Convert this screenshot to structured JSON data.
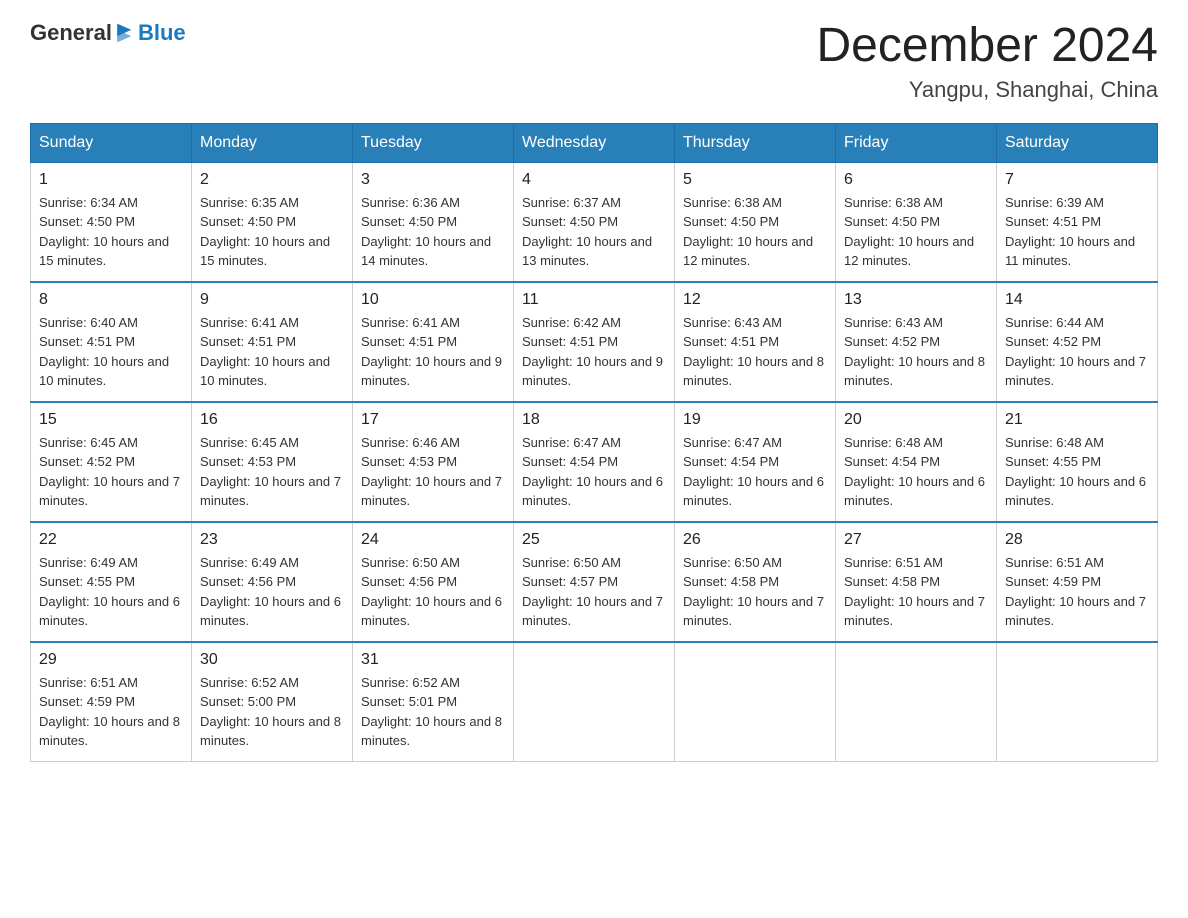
{
  "header": {
    "logo_general": "General",
    "logo_blue": "Blue",
    "month": "December 2024",
    "location": "Yangpu, Shanghai, China"
  },
  "days_of_week": [
    "Sunday",
    "Monday",
    "Tuesday",
    "Wednesday",
    "Thursday",
    "Friday",
    "Saturday"
  ],
  "weeks": [
    [
      {
        "day": "1",
        "sunrise": "6:34 AM",
        "sunset": "4:50 PM",
        "daylight": "10 hours and 15 minutes."
      },
      {
        "day": "2",
        "sunrise": "6:35 AM",
        "sunset": "4:50 PM",
        "daylight": "10 hours and 15 minutes."
      },
      {
        "day": "3",
        "sunrise": "6:36 AM",
        "sunset": "4:50 PM",
        "daylight": "10 hours and 14 minutes."
      },
      {
        "day": "4",
        "sunrise": "6:37 AM",
        "sunset": "4:50 PM",
        "daylight": "10 hours and 13 minutes."
      },
      {
        "day": "5",
        "sunrise": "6:38 AM",
        "sunset": "4:50 PM",
        "daylight": "10 hours and 12 minutes."
      },
      {
        "day": "6",
        "sunrise": "6:38 AM",
        "sunset": "4:50 PM",
        "daylight": "10 hours and 12 minutes."
      },
      {
        "day": "7",
        "sunrise": "6:39 AM",
        "sunset": "4:51 PM",
        "daylight": "10 hours and 11 minutes."
      }
    ],
    [
      {
        "day": "8",
        "sunrise": "6:40 AM",
        "sunset": "4:51 PM",
        "daylight": "10 hours and 10 minutes."
      },
      {
        "day": "9",
        "sunrise": "6:41 AM",
        "sunset": "4:51 PM",
        "daylight": "10 hours and 10 minutes."
      },
      {
        "day": "10",
        "sunrise": "6:41 AM",
        "sunset": "4:51 PM",
        "daylight": "10 hours and 9 minutes."
      },
      {
        "day": "11",
        "sunrise": "6:42 AM",
        "sunset": "4:51 PM",
        "daylight": "10 hours and 9 minutes."
      },
      {
        "day": "12",
        "sunrise": "6:43 AM",
        "sunset": "4:51 PM",
        "daylight": "10 hours and 8 minutes."
      },
      {
        "day": "13",
        "sunrise": "6:43 AM",
        "sunset": "4:52 PM",
        "daylight": "10 hours and 8 minutes."
      },
      {
        "day": "14",
        "sunrise": "6:44 AM",
        "sunset": "4:52 PM",
        "daylight": "10 hours and 7 minutes."
      }
    ],
    [
      {
        "day": "15",
        "sunrise": "6:45 AM",
        "sunset": "4:52 PM",
        "daylight": "10 hours and 7 minutes."
      },
      {
        "day": "16",
        "sunrise": "6:45 AM",
        "sunset": "4:53 PM",
        "daylight": "10 hours and 7 minutes."
      },
      {
        "day": "17",
        "sunrise": "6:46 AM",
        "sunset": "4:53 PM",
        "daylight": "10 hours and 7 minutes."
      },
      {
        "day": "18",
        "sunrise": "6:47 AM",
        "sunset": "4:54 PM",
        "daylight": "10 hours and 6 minutes."
      },
      {
        "day": "19",
        "sunrise": "6:47 AM",
        "sunset": "4:54 PM",
        "daylight": "10 hours and 6 minutes."
      },
      {
        "day": "20",
        "sunrise": "6:48 AM",
        "sunset": "4:54 PM",
        "daylight": "10 hours and 6 minutes."
      },
      {
        "day": "21",
        "sunrise": "6:48 AM",
        "sunset": "4:55 PM",
        "daylight": "10 hours and 6 minutes."
      }
    ],
    [
      {
        "day": "22",
        "sunrise": "6:49 AM",
        "sunset": "4:55 PM",
        "daylight": "10 hours and 6 minutes."
      },
      {
        "day": "23",
        "sunrise": "6:49 AM",
        "sunset": "4:56 PM",
        "daylight": "10 hours and 6 minutes."
      },
      {
        "day": "24",
        "sunrise": "6:50 AM",
        "sunset": "4:56 PM",
        "daylight": "10 hours and 6 minutes."
      },
      {
        "day": "25",
        "sunrise": "6:50 AM",
        "sunset": "4:57 PM",
        "daylight": "10 hours and 7 minutes."
      },
      {
        "day": "26",
        "sunrise": "6:50 AM",
        "sunset": "4:58 PM",
        "daylight": "10 hours and 7 minutes."
      },
      {
        "day": "27",
        "sunrise": "6:51 AM",
        "sunset": "4:58 PM",
        "daylight": "10 hours and 7 minutes."
      },
      {
        "day": "28",
        "sunrise": "6:51 AM",
        "sunset": "4:59 PM",
        "daylight": "10 hours and 7 minutes."
      }
    ],
    [
      {
        "day": "29",
        "sunrise": "6:51 AM",
        "sunset": "4:59 PM",
        "daylight": "10 hours and 8 minutes."
      },
      {
        "day": "30",
        "sunrise": "6:52 AM",
        "sunset": "5:00 PM",
        "daylight": "10 hours and 8 minutes."
      },
      {
        "day": "31",
        "sunrise": "6:52 AM",
        "sunset": "5:01 PM",
        "daylight": "10 hours and 8 minutes."
      },
      null,
      null,
      null,
      null
    ]
  ],
  "labels": {
    "sunrise": "Sunrise:",
    "sunset": "Sunset:",
    "daylight": "Daylight:"
  }
}
